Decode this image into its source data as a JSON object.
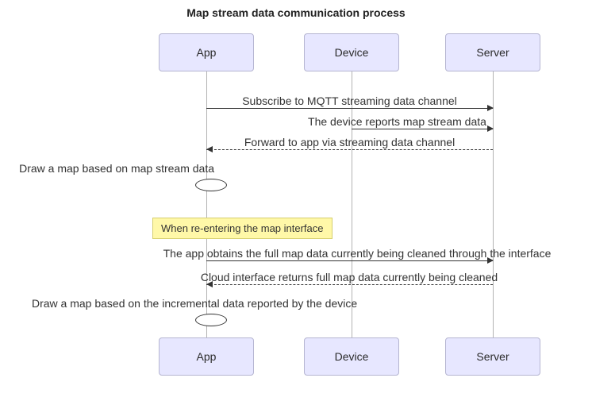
{
  "title": "Map stream data communication process",
  "actors": {
    "app": "App",
    "device": "Device",
    "server": "Server"
  },
  "messages": {
    "m1": "Subscribe to MQTT streaming data channel",
    "m2": "The device reports map stream data",
    "m3": "Forward to  app via streaming data channel",
    "self1": "Draw a map based on map stream data",
    "note1": "When re-entering the map interface",
    "m4": "The  app  obtains the full map data currently being cleaned through the interface",
    "m5": "Cloud interface returns full map data currently being cleaned",
    "self2": "Draw a map based on the incremental data reported by the device"
  }
}
